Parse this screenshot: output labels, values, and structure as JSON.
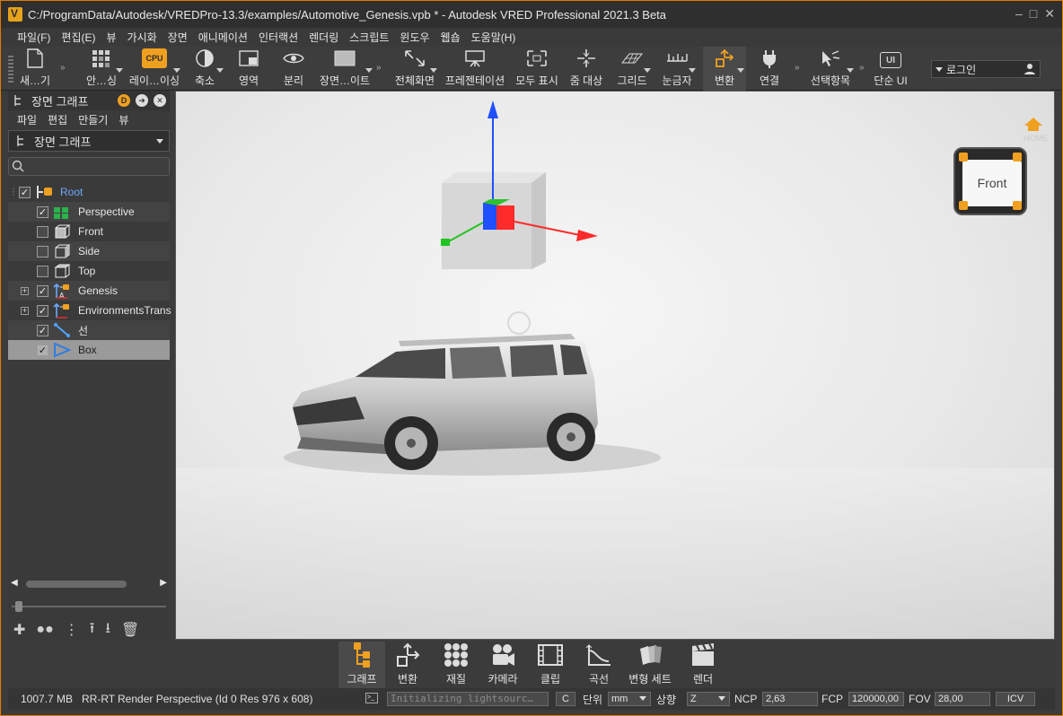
{
  "window": {
    "title": "C:/ProgramData/Autodesk/VREDPro-13.3/examples/Automotive_Genesis.vpb * - Autodesk VRED Professional 2021.3 Beta",
    "accent_color": "#e07b00"
  },
  "menubar": [
    "파일(F)",
    "편집(E)",
    "뷰",
    "가시화",
    "장면",
    "애니메이션",
    "인터랙션",
    "렌더링",
    "스크립트",
    "윈도우",
    "웹숍",
    "도움말(H)"
  ],
  "toolbar": {
    "items": [
      {
        "label": "새…기",
        "icon": "new-file-icon"
      },
      {
        "label": "안…싱",
        "icon": "antialiasing-icon"
      },
      {
        "label": "레이…이싱",
        "icon": "cpu-raytracing-icon"
      },
      {
        "label": "축소",
        "icon": "reduce-icon"
      },
      {
        "label": "영역",
        "icon": "region-icon"
      },
      {
        "label": "분리",
        "icon": "eye-split-icon"
      },
      {
        "label": "장면…이트",
        "icon": "scene-plate-icon"
      },
      {
        "label": "전체화면",
        "icon": "fullscreen-icon"
      },
      {
        "label": "프레젠테이션",
        "icon": "presentation-icon"
      },
      {
        "label": "모두 표시",
        "icon": "show-all-icon"
      },
      {
        "label": "줌 대상",
        "icon": "zoom-target-icon"
      },
      {
        "label": "그리드",
        "icon": "grid-icon"
      },
      {
        "label": "눈금자",
        "icon": "ruler-icon"
      },
      {
        "label": "변환",
        "icon": "transform-icon"
      },
      {
        "label": "연결",
        "icon": "connect-plug-icon"
      },
      {
        "label": "선택항목",
        "icon": "selection-tool-icon"
      },
      {
        "label": "단순 UI",
        "icon": "simple-ui-icon"
      }
    ],
    "cpu_badge": "CPU",
    "ui_badge": "UI",
    "login": "로그인"
  },
  "scene_graph": {
    "title": "장면 그래프",
    "header_badge": "D",
    "menu": [
      "파일",
      "편집",
      "만들기",
      "뷰"
    ],
    "combo_value": "장면 그래프",
    "search_placeholder": "",
    "nodes": [
      {
        "label": "Root",
        "icon": "group-node-icon",
        "checked": true,
        "level": 0
      },
      {
        "label": "Perspective",
        "icon": "perspective-camera-icon",
        "checked": true,
        "level": 1
      },
      {
        "label": "Front",
        "icon": "front-camera-icon",
        "checked": false,
        "level": 1
      },
      {
        "label": "Side",
        "icon": "side-camera-icon",
        "checked": false,
        "level": 1
      },
      {
        "label": "Top",
        "icon": "top-camera-icon",
        "checked": false,
        "level": 1
      },
      {
        "label": "Genesis",
        "icon": "transform-node-icon",
        "checked": true,
        "level": 1
      },
      {
        "label": "EnvironmentsTrans",
        "icon": "transform-node-icon",
        "checked": true,
        "level": 1
      },
      {
        "label": "선",
        "icon": "line-node-icon",
        "checked": true,
        "level": 1
      },
      {
        "label": "Box",
        "icon": "geometry-node-icon",
        "checked": true,
        "level": 1
      }
    ]
  },
  "viewport": {
    "navcube_label": "Front",
    "home_label": "HOME"
  },
  "modules": [
    {
      "label": "그래프",
      "icon": "graph-module-icon"
    },
    {
      "label": "변환",
      "icon": "transform-module-icon"
    },
    {
      "label": "재질",
      "icon": "materials-module-icon"
    },
    {
      "label": "카메라",
      "icon": "camera-module-icon"
    },
    {
      "label": "클립",
      "icon": "clips-module-icon"
    },
    {
      "label": "곡선",
      "icon": "curves-module-icon"
    },
    {
      "label": "변형 세트",
      "icon": "variant-sets-module-icon"
    },
    {
      "label": "렌더",
      "icon": "render-module-icon"
    }
  ],
  "status": {
    "memory": "1007.7 MB",
    "mode": "RR-RT",
    "render_info": "Render Perspective (Id 0 Res 976 x 608)",
    "terminal_text": "Initializing lightsourc…",
    "c_button": "C",
    "unit_label": "단위",
    "unit_value": "mm",
    "up_label": "상향",
    "up_value": "Z",
    "ncp_label": "NCP",
    "ncp_value": "2,63",
    "fcp_label": "FCP",
    "fcp_value": "120000,00",
    "fov_label": "FOV",
    "fov_value": "28,00",
    "icv_button": "ICV"
  }
}
